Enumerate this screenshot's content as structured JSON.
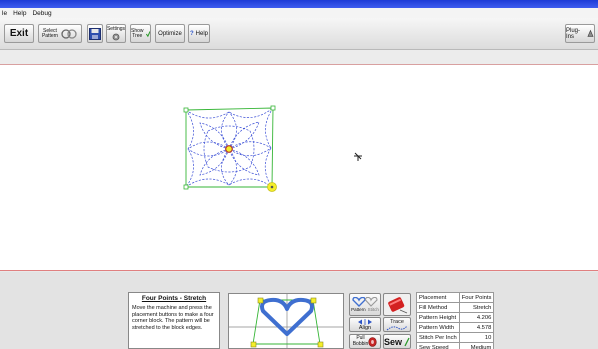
{
  "menu": [
    "le",
    "Help",
    "Debug"
  ],
  "toolbar": {
    "exit": "Exit",
    "select_pattern_1": "Select",
    "select_pattern_2": "Pattern",
    "settings": "Settings",
    "show_tree_1": "Show",
    "show_tree_2": "Tree",
    "optimize": "Optimize",
    "help": "Help",
    "plugins": "Plug-Ins"
  },
  "description": {
    "title": "Four Points - Stretch",
    "body": "Move the machine and press the placement buttons to make a four corner block. The pattern will be stretched to the block edges."
  },
  "controls": {
    "pattern": "Pattern",
    "stitch": "Stitch",
    "align": "Align",
    "trace": "Trace",
    "pull_bobbin_1": "Pull",
    "pull_bobbin_2": "Bobbin",
    "sew": "Sew"
  },
  "properties": [
    {
      "label": "Placement",
      "value": "Four Points"
    },
    {
      "label": "Fill Method",
      "value": "Stretch"
    },
    {
      "label": "Pattern Height",
      "value": "4.206"
    },
    {
      "label": "Pattern Width",
      "value": "4.578"
    },
    {
      "label": "Stitch Per Inch",
      "value": "10"
    },
    {
      "label": "Sew Speed",
      "value": "Medium"
    }
  ],
  "colors": {
    "titlebar": "#2a48e0",
    "pattern_line": "#3b4fd6",
    "guide_line": "#35b535",
    "preview_heart": "#3f6fd0",
    "marker_yellow": "#f4ee2a"
  }
}
